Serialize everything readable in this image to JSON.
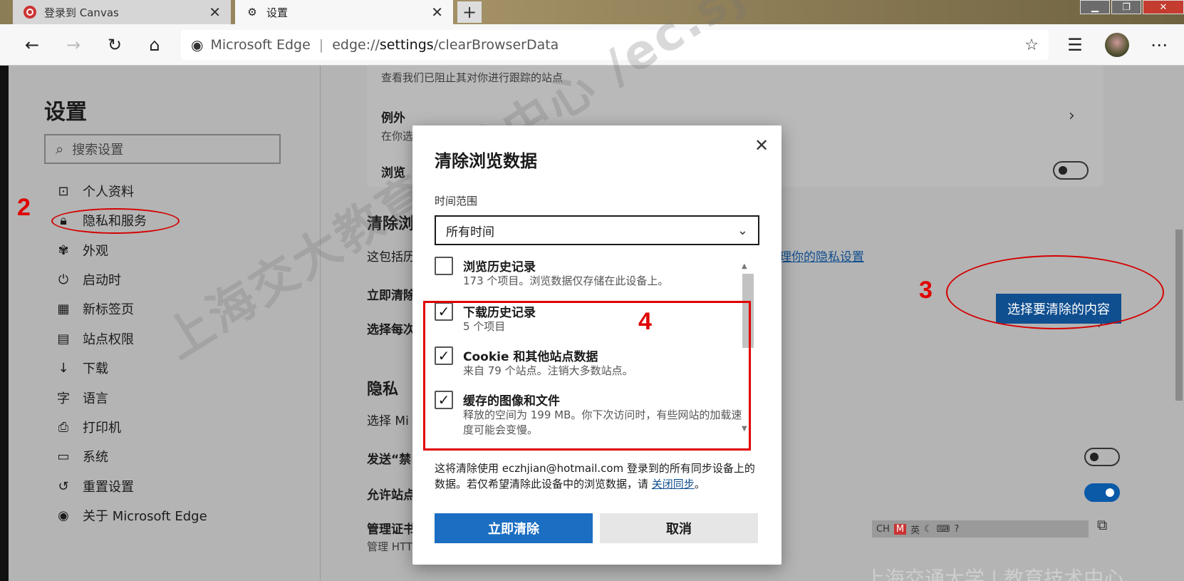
{
  "tabs": [
    {
      "title": "登录到 Canvas",
      "icon": "canvas-logo-icon"
    },
    {
      "title": "设置",
      "icon": "gear-icon"
    }
  ],
  "window_controls": [
    "▁",
    "❐",
    "✕"
  ],
  "toolbar": {
    "browser_name": "Microsoft Edge",
    "url_prefix": "edge://",
    "url_host": "settings",
    "url_path": "/clearBrowserData"
  },
  "sidebar": {
    "title": "设置",
    "search_placeholder": "搜索设置",
    "items": [
      {
        "label": "个人资料",
        "icon": "profile-icon"
      },
      {
        "label": "隐私和服务",
        "icon": "lock-icon"
      },
      {
        "label": "外观",
        "icon": "palette-icon"
      },
      {
        "label": "启动时",
        "icon": "power-icon"
      },
      {
        "label": "新标签页",
        "icon": "grid-icon"
      },
      {
        "label": "站点权限",
        "icon": "site-permissions-icon"
      },
      {
        "label": "下载",
        "icon": "download-icon"
      },
      {
        "label": "语言",
        "icon": "language-icon"
      },
      {
        "label": "打印机",
        "icon": "printer-icon"
      },
      {
        "label": "系统",
        "icon": "laptop-icon"
      },
      {
        "label": "重置设置",
        "icon": "reset-icon"
      },
      {
        "label": "关于 Microsoft Edge",
        "icon": "edge-logo-icon"
      }
    ]
  },
  "main": {
    "tracking_sub": "查看我们已阻止其对你进行跟踪的站点",
    "exceptions_title": "例外",
    "exceptions_sub": "在你选",
    "browse_label": "浏览",
    "clear_heading": "清除浏",
    "clear_desc": "这包括历",
    "privacy_link": "理你的隐私设置",
    "clear_now_label": "立即清除",
    "choose_each_label": "选择每次",
    "choose_button": "选择要清除的内容",
    "privacy_heading": "隐私",
    "privacy_sub": "选择 Mi",
    "send_label": "发送“禁",
    "allow_label": "允许站点",
    "cert_label": "管理证书",
    "cert_sub": "管理 HTTPS/SSL 证书和设置"
  },
  "annotations": [
    "2",
    "3",
    "4"
  ],
  "ime_bar": {
    "lang": "CH",
    "mode": "英"
  },
  "watermark": "上海交大教育技术中心 /ec.sjtu.edu",
  "watermark_footer": "上海交通大学 | 教育技术中心",
  "dialog": {
    "title": "清除浏览数据",
    "range_label": "时间范围",
    "range_value": "所有时间",
    "items": [
      {
        "label": "浏览历史记录",
        "desc": "173 个项目。浏览数据仅存储在此设备上。",
        "checked": false
      },
      {
        "label": "下载历史记录",
        "desc": "5 个项目",
        "checked": true
      },
      {
        "label": "Cookie 和其他站点数据",
        "desc": "来自 79 个站点。注销大多数站点。",
        "checked": true
      },
      {
        "label": "缓存的图像和文件",
        "desc": "释放的空间为 199 MB。你下次访问时，有些网站的加载速度可能会变慢。",
        "checked": true
      }
    ],
    "sync_note_1": "这将清除使用 eczhjian@hotmail.com 登录到的所有同步设备上的数据。若仅希望清除此设备中的浏览数据，请",
    "sync_link": "关闭同步",
    "sync_note_2": "。",
    "clear_button": "立即清除",
    "cancel_button": "取消"
  },
  "colors": {
    "accent": "#1b6ec2",
    "annotation": "#e00000",
    "overlay": "#b4b4b4"
  }
}
